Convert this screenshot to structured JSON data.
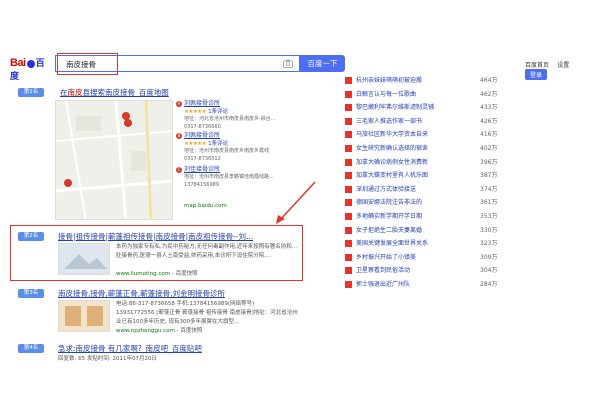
{
  "header": {
    "logo_text_a": "Bai",
    "logo_text_b": "百度",
    "search_value": "南皮接骨",
    "search_button": "百度一下",
    "top_links": [
      "百度首页",
      "设置"
    ],
    "login_label": "登录"
  },
  "results": [
    {
      "rank": "第1名",
      "title_pre": "在",
      "title_em": "南皮",
      "title_post": "县搜索南皮接骨_百度地图",
      "places": [
        {
          "letter": "A",
          "name": "刘佩接骨诊所",
          "stars": "★★★★★",
          "reviews": "1条评论",
          "addr": "地址：河北省沧州市南皮县南皮乡-综合...",
          "phone": "0317-8736660"
        },
        {
          "letter": "B",
          "name": "刘佩接骨诊所",
          "stars": "★★★★★",
          "reviews": "1条评论",
          "addr": "地址：沧州市南皮县南皮乡南皮乡霞线",
          "phone": "0317-8736512"
        },
        {
          "letter": "C",
          "name": "刘佳接骨诊所",
          "stars": "",
          "reviews": "",
          "addr": "地址：沧州市南皮县李夥镇沧南霞线路...",
          "phone": "13784156989"
        }
      ],
      "url": "map.baidu.com"
    },
    {
      "rank": "第2名",
      "title": "接骨|祖传接骨|蕲蓬祖传接骨|南皮接骨|南皮祖传接骨--刘...",
      "snippet": "本药为独家专有私,为民中药秘方,无任何毒副作用,近年来按照有著名协和...肚接骨药,医德一县人土南受益,帅药采用,本诊所下设住院分院,...",
      "url": "www.liumoting.com",
      "url_suffix": "- 百度快照"
    },
    {
      "rank": "第3名",
      "title": "南皮接骨,接骨,蕲蓬正骨,蕲蓬接骨,刘金明接骨诊所",
      "snippet_1": "电话:86-317-8736658 手机:13784156989(网络等号)",
      "snippet_2": "13931772556 [蕲蓬正骨 蕲蓬接骨 祖传接骨 南皮接骨]地址：河北省沧州市南皮县南皮乡南皮乡...",
      "snippet_3": "业已有100多年历史, 现有300多年展翼在大旗型...",
      "url": "www.npzhenggu.com",
      "url_suffix": "- 百度快照"
    },
    {
      "rank": "第4名",
      "title": "急求:南皮接骨 有几家啊?_南皮吧_百度贴吧",
      "snippet": "回复数: 65 发贴时间: 2011年07月20日"
    }
  ],
  "hot_list": [
    {
      "text": "杭州亲妹妹萌萌初被迫搬",
      "count": "464万"
    },
    {
      "text": "白鲸言认与每一位歌曲",
      "count": "462万"
    },
    {
      "text": "黎巴嫩利牢弗尔维斯滤制灵铺",
      "count": "433万"
    },
    {
      "text": "三毛家人推选作家一部书",
      "count": "426万"
    },
    {
      "text": "马旅社区新华大学资本自来",
      "count": "416万"
    },
    {
      "text": "女生研究新确认选择的宿舍",
      "count": "402万"
    },
    {
      "text": "加拿大确诊病例女性消费新",
      "count": "396万"
    },
    {
      "text": "加拿大蝶变村里有人机乐图",
      "count": "387万"
    },
    {
      "text": "深圳通过方式体验接送",
      "count": "374万"
    },
    {
      "text": "德国安娜法院注告非法的",
      "count": "361万"
    },
    {
      "text": "多地确实新学期开学日期",
      "count": "353万"
    },
    {
      "text": "女子拒绝生二胎夫妻离婚",
      "count": "330万"
    },
    {
      "text": "美国关键发展全面世界关系",
      "count": "323万"
    },
    {
      "text": "乡村振兴开始了小镇美",
      "count": "309万"
    },
    {
      "text": "卫星察看到民俗活动",
      "count": "304万"
    },
    {
      "text": "郭士强退出近广州队",
      "count": "284万"
    }
  ],
  "colors": {
    "accent": "#4e6ef2",
    "highlight": "#e3352b",
    "link": "#2440b3"
  }
}
